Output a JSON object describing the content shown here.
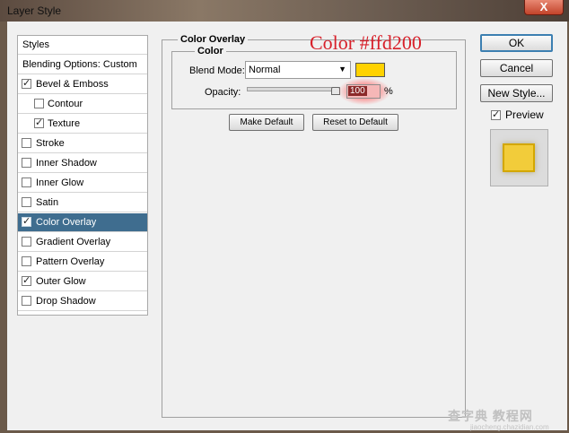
{
  "window": {
    "title": "Layer Style",
    "close_label": "X"
  },
  "styles_list": {
    "header": "Styles",
    "blending": "Blending Options: Custom",
    "items": [
      {
        "label": "Bevel & Emboss",
        "checked": true,
        "indent": false,
        "selected": false
      },
      {
        "label": "Contour",
        "checked": false,
        "indent": true,
        "selected": false
      },
      {
        "label": "Texture",
        "checked": true,
        "indent": true,
        "selected": false
      },
      {
        "label": "Stroke",
        "checked": false,
        "indent": false,
        "selected": false
      },
      {
        "label": "Inner Shadow",
        "checked": false,
        "indent": false,
        "selected": false
      },
      {
        "label": "Inner Glow",
        "checked": false,
        "indent": false,
        "selected": false
      },
      {
        "label": "Satin",
        "checked": false,
        "indent": false,
        "selected": false
      },
      {
        "label": "Color Overlay",
        "checked": true,
        "indent": false,
        "selected": true
      },
      {
        "label": "Gradient Overlay",
        "checked": false,
        "indent": false,
        "selected": false
      },
      {
        "label": "Pattern Overlay",
        "checked": false,
        "indent": false,
        "selected": false
      },
      {
        "label": "Outer Glow",
        "checked": true,
        "indent": false,
        "selected": false
      },
      {
        "label": "Drop Shadow",
        "checked": false,
        "indent": false,
        "selected": false
      }
    ]
  },
  "color_overlay": {
    "section_title": "Color Overlay",
    "group_title": "Color",
    "blend_mode_label": "Blend Mode:",
    "blend_mode_value": "Normal",
    "overlay_color": "#ffd200",
    "opacity_label": "Opacity:",
    "opacity_value": "100",
    "opacity_unit": "%",
    "make_default_label": "Make Default",
    "reset_default_label": "Reset to Default"
  },
  "right_panel": {
    "ok_label": "OK",
    "cancel_label": "Cancel",
    "new_style_label": "New Style...",
    "preview_label": "Preview",
    "preview_checked": true,
    "preview_color": "#f2cc3a"
  },
  "annotation": {
    "text": "Color #ffd200"
  },
  "watermark": {
    "text": "查字典 教程网",
    "sub": "jiaocheng.chazidian.com"
  }
}
